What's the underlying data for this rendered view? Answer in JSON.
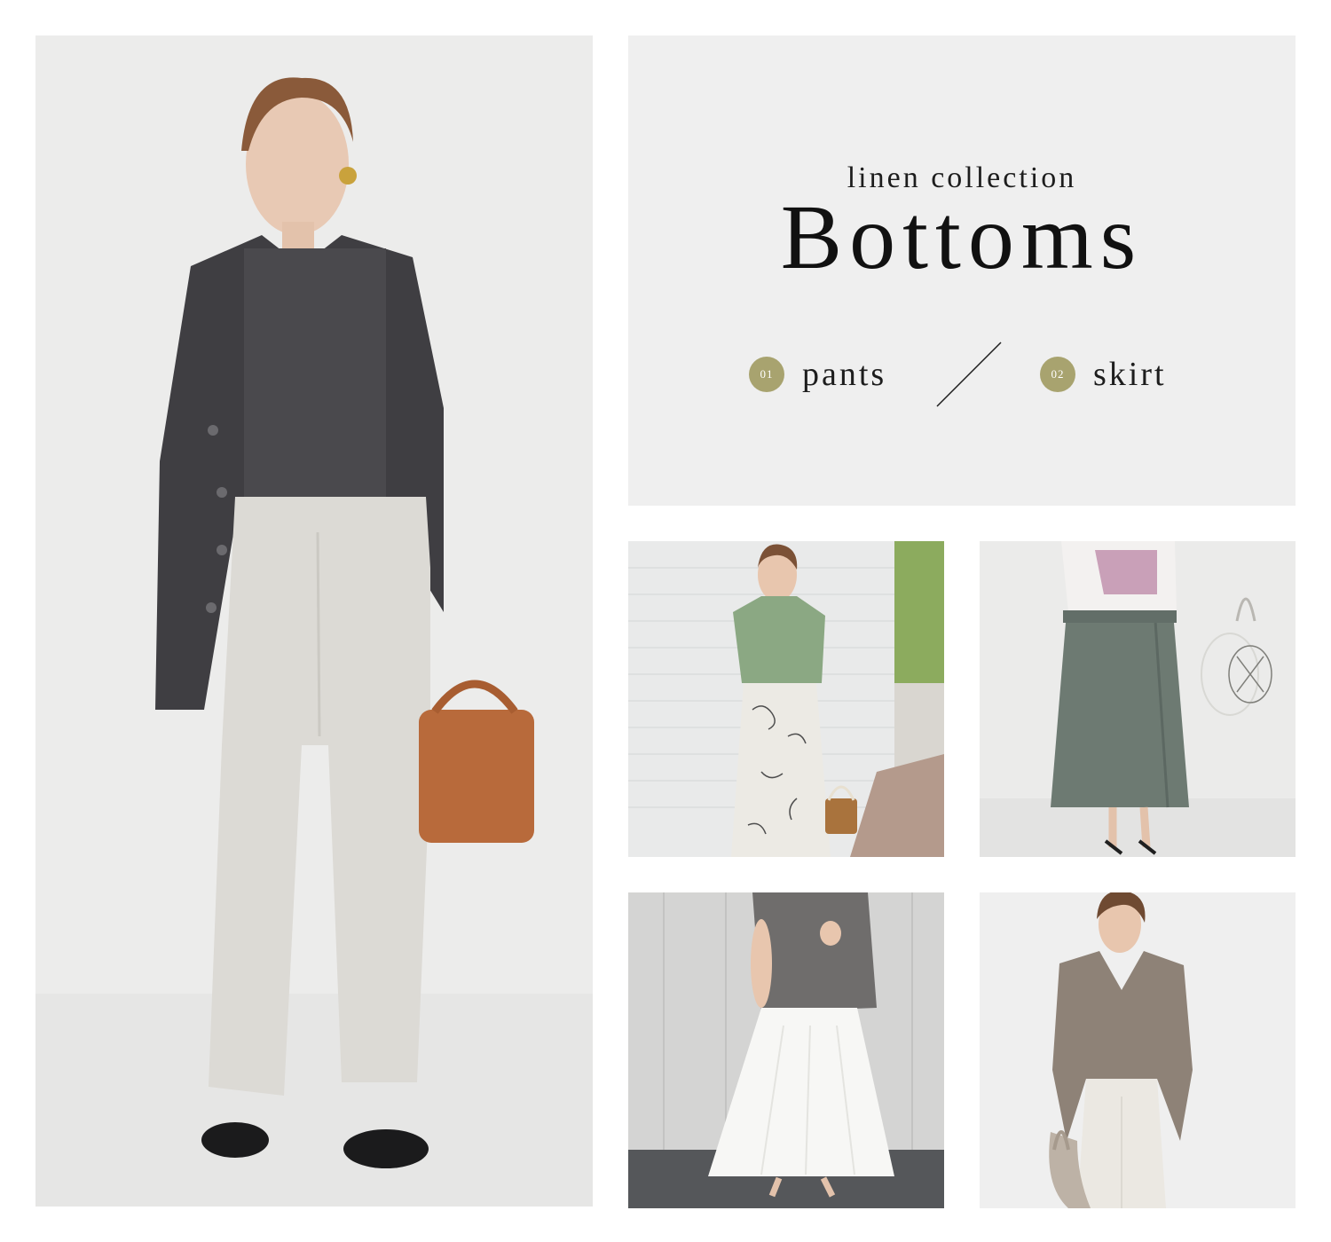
{
  "header": {
    "subtitle": "linen collection",
    "title": "Bottoms"
  },
  "categories": [
    {
      "number": "01",
      "label": "pants"
    },
    {
      "number": "02",
      "label": "skirt"
    }
  ],
  "colors": {
    "panel_background": "#efefef",
    "badge": "#a8a36f",
    "text": "#1d1d1d"
  }
}
